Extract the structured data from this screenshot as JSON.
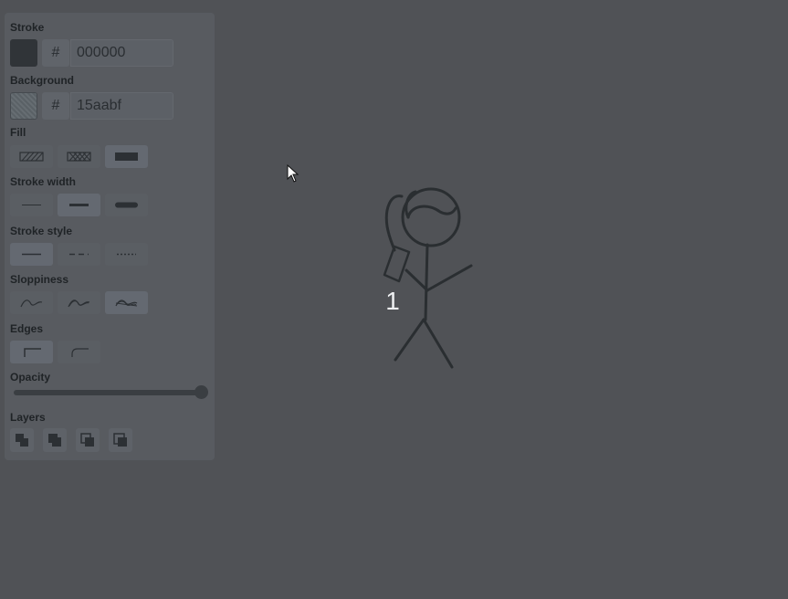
{
  "panel": {
    "stroke": {
      "label": "Stroke",
      "hash": "#",
      "value": "000000",
      "swatch_color": "#303438"
    },
    "background": {
      "label": "Background",
      "hash": "#",
      "value": "15aabf",
      "swatch_color": "#5f666b"
    },
    "fill": {
      "label": "Fill",
      "options": [
        "hachure-icon",
        "cross-hatch-icon",
        "solid-icon"
      ],
      "selected": 2
    },
    "stroke_width": {
      "label": "Stroke width",
      "options": [
        "thin-icon",
        "bold-icon",
        "extra-bold-icon"
      ],
      "selected": 1
    },
    "stroke_style": {
      "label": "Stroke style",
      "options": [
        "solid-line-icon",
        "dashed-line-icon",
        "dotted-line-icon"
      ],
      "selected": 0
    },
    "sloppiness": {
      "label": "Sloppiness",
      "options": [
        "architect-icon",
        "artist-icon",
        "cartoonist-icon"
      ],
      "selected": 2
    },
    "edges": {
      "label": "Edges",
      "options": [
        "sharp-edge-icon",
        "round-edge-icon"
      ],
      "selected": 0
    },
    "opacity": {
      "label": "Opacity",
      "value": 100
    },
    "layers": {
      "label": "Layers",
      "options": [
        "send-to-back-icon",
        "send-backward-icon",
        "bring-forward-icon",
        "bring-to-front-icon"
      ]
    }
  },
  "canvas": {
    "number_label": "1"
  },
  "colors": {
    "background": "#505256",
    "panel": "#585b60",
    "stroke": "#2a2e31"
  }
}
